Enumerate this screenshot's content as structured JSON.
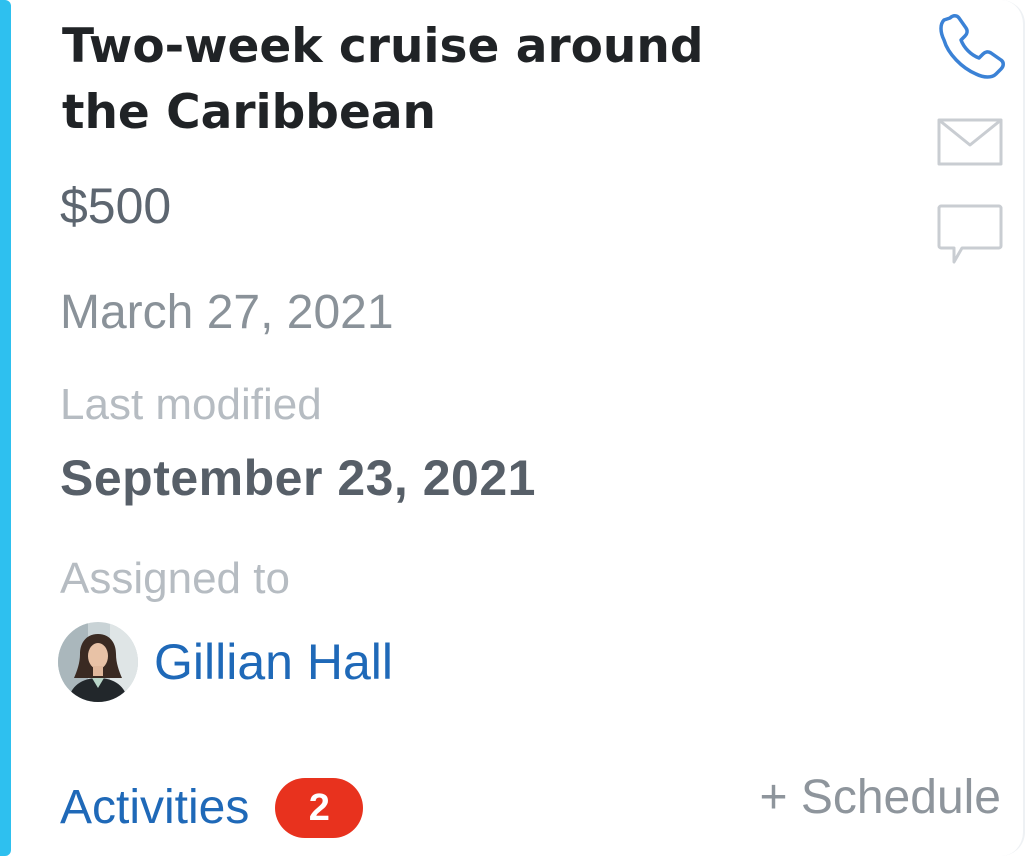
{
  "deal": {
    "title": "Two-week cruise around the Caribbean",
    "amount": "$500",
    "date": "March 27, 2021",
    "last_modified_label": "Last modified",
    "last_modified_value": "September 23, 2021",
    "assigned_label": "Assigned to",
    "assignee_name": "Gillian Hall"
  },
  "actions": {
    "phone_icon": "phone-icon",
    "mail_icon": "mail-icon",
    "chat_icon": "chat-icon"
  },
  "footer": {
    "activities_label": "Activities",
    "activities_count": "2",
    "schedule_label": "+ Schedule"
  },
  "colors": {
    "accent": "#2ec0ef",
    "link": "#1f69b8",
    "badge": "#e8321e"
  }
}
